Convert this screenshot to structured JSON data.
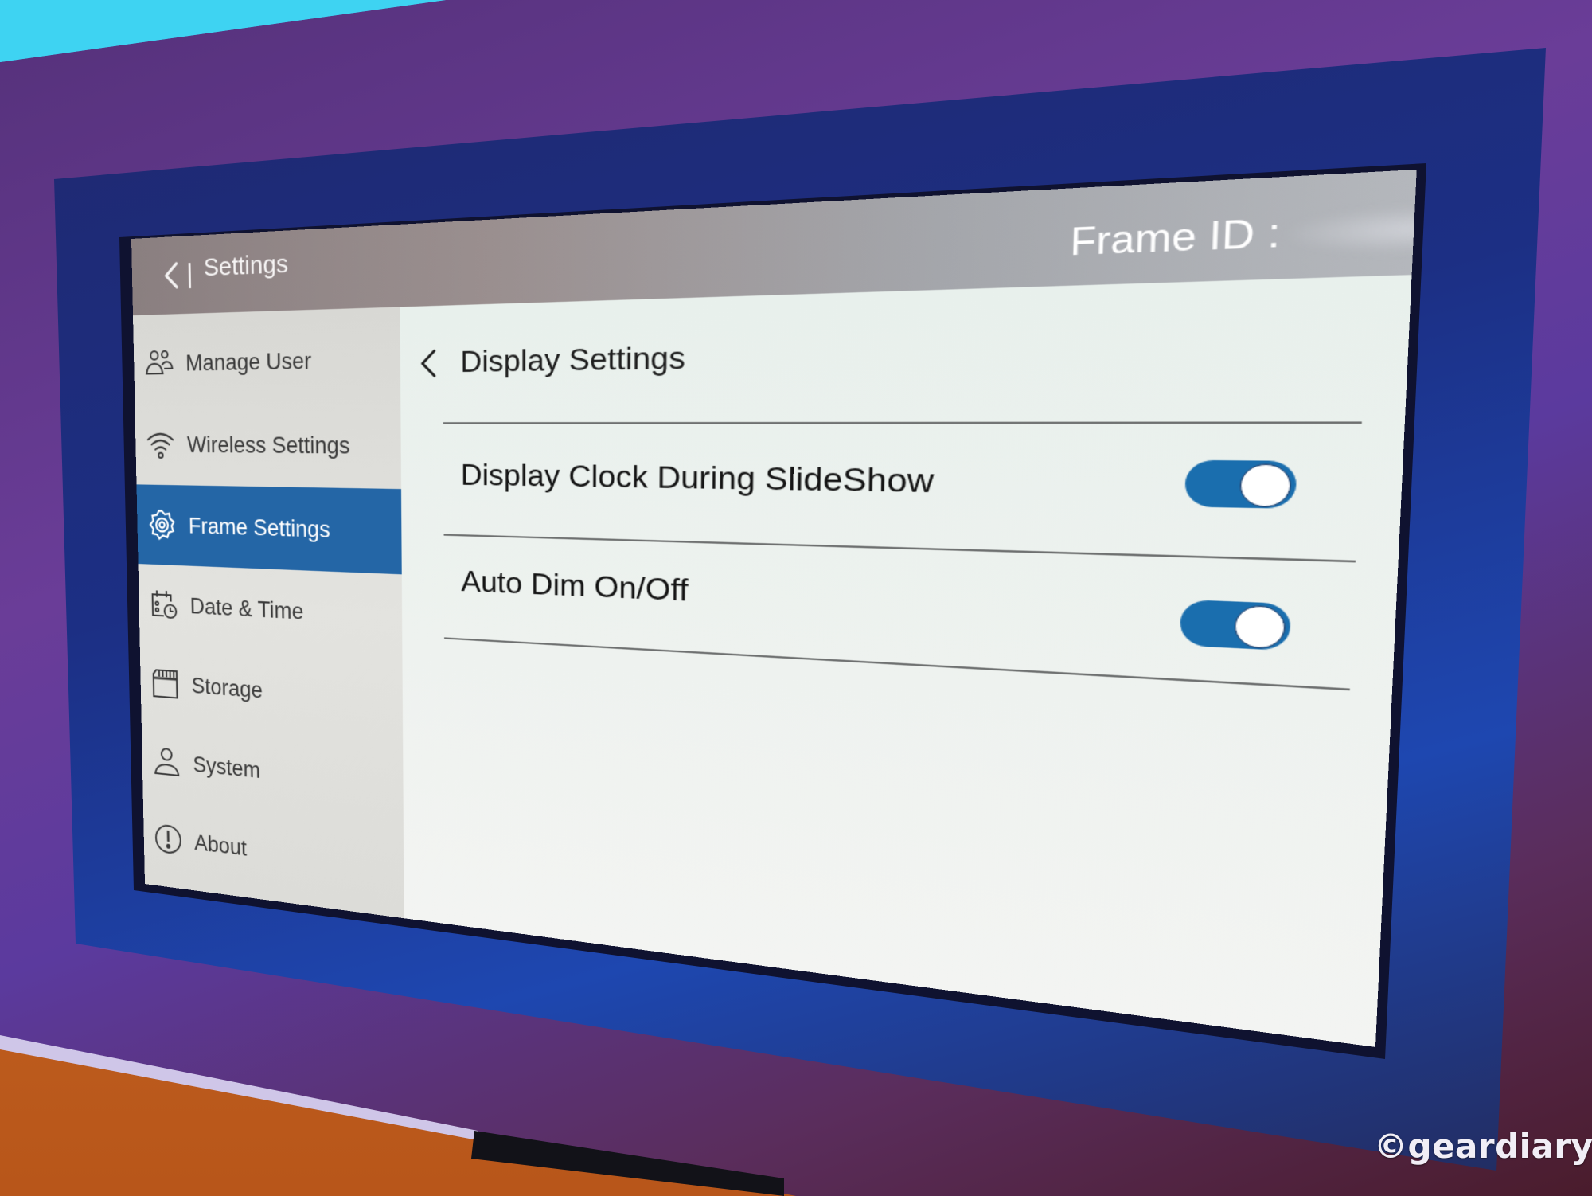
{
  "header": {
    "back_icon": "chevron-left-icon",
    "title": "Settings",
    "frame_id_label": "Frame ID :",
    "frame_id_value": ""
  },
  "sidebar": {
    "items": [
      {
        "label": "Manage User",
        "icon": "users-icon",
        "active": false
      },
      {
        "label": "Wireless Settings",
        "icon": "wifi-icon",
        "active": false
      },
      {
        "label": "Frame Settings",
        "icon": "gear-icon",
        "active": true
      },
      {
        "label": "Date & Time",
        "icon": "calendar-clock-icon",
        "active": false
      },
      {
        "label": "Storage",
        "icon": "sd-card-icon",
        "active": false
      },
      {
        "label": "System",
        "icon": "person-icon",
        "active": false
      },
      {
        "label": "About",
        "icon": "info-alert-icon",
        "active": false
      }
    ]
  },
  "main": {
    "back_icon": "chevron-left-icon",
    "title": "Display Settings",
    "settings": [
      {
        "label": "Display Clock During SlideShow",
        "enabled": true
      },
      {
        "label": "Auto Dim On/Off",
        "enabled": true
      }
    ]
  },
  "colors": {
    "accent": "#2466a6",
    "toggle_on": "#1a6eae"
  },
  "watermark": "©geardiary"
}
